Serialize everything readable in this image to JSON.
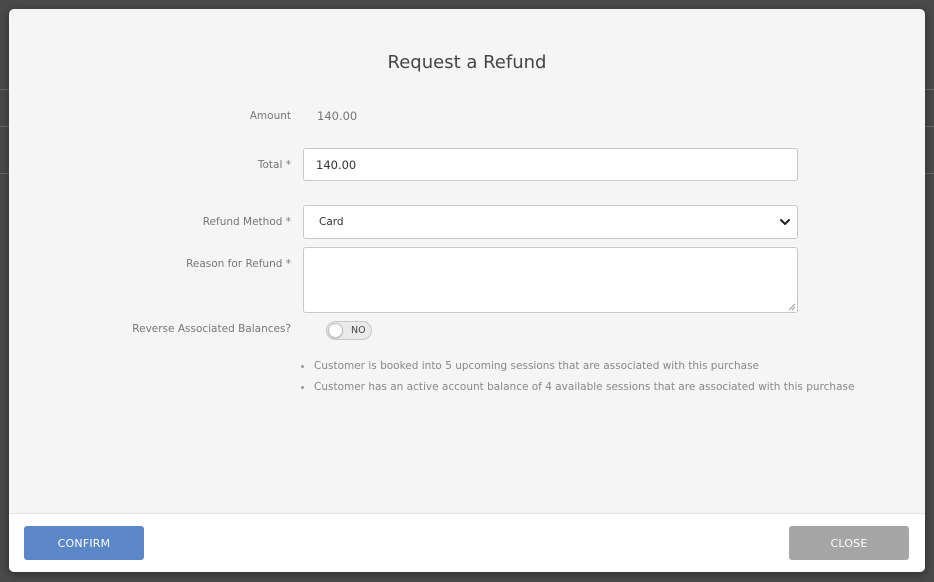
{
  "colors": {
    "confirm_button": "#5b87c8",
    "close_button": "#a6a6a6",
    "modal_background": "#f5f5f5",
    "backdrop": "#4a4a4a"
  },
  "modal": {
    "title": "Request a Refund",
    "amount": {
      "label": "Amount",
      "value": "140.00"
    },
    "total": {
      "label": "Total *",
      "value": "140.00"
    },
    "refund_method": {
      "label": "Refund Method *",
      "selected": "Card"
    },
    "reason": {
      "label": "Reason for Refund *",
      "value": ""
    },
    "reverse_balances": {
      "label": "Reverse Associated Balances?",
      "toggle_text": "NO",
      "on": false
    },
    "notes": [
      "Customer is booked into 5 upcoming sessions that are associated with this purchase",
      "Customer has an active account balance of 4 available sessions that are associated with this purchase"
    ]
  },
  "footer": {
    "confirm_label": "CONFIRM",
    "close_label": "CLOSE"
  },
  "icons": {
    "dropdown": "chevron-down-icon",
    "resize": "resize-grip-icon"
  }
}
